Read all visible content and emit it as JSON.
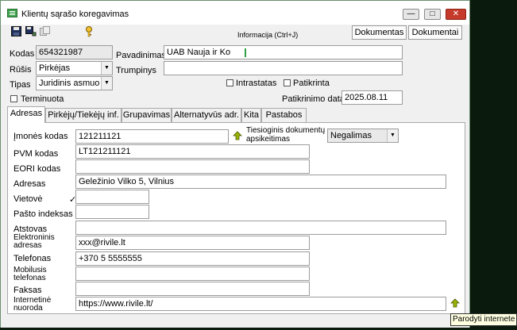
{
  "window": {
    "title": "Klientų sąrašo koregavimas",
    "controls": {
      "minimize": "—",
      "maximize": "□",
      "close": "✕"
    }
  },
  "toolbar": {
    "icons": [
      "save-icon",
      "save-copy-icon",
      "copy-icon",
      "key-icon"
    ],
    "info_text": "Informacija (Ctrl+J)",
    "buttons": [
      "Dokumentas",
      "Dokumentai"
    ]
  },
  "header": {
    "kodas_label": "Kodas",
    "kodas_value": "654321987",
    "rusis_label": "Rūšis",
    "rusis_value": "Pirkėjas",
    "tipas_label": "Tipas",
    "tipas_value": "Juridinis asmuo",
    "terminuota_label": "Terminuota",
    "pavadinimas_label": "Pavadinimas",
    "pavadinimas_value": "UAB Nauja ir Ko",
    "trumpinys_label": "Trumpinys",
    "trumpinys_value": "",
    "intrastatas_label": "Intrastatas",
    "patikrinta_label": "Patikrinta",
    "patikrinimo_data_label": "Patikrinimo data",
    "patikrinimo_data_value": "2025.08.11"
  },
  "tabs": [
    "Adresas",
    "Pirkėjų/Tiekėjų inf.",
    "Grupavimas",
    "Alternatyvūs adr.",
    "Kita",
    "Pastabos"
  ],
  "adresas": {
    "imones_kodas_label": "Įmonės kodas",
    "imones_kodas_value": "121211121",
    "tiesioginis_label_1": "Tiesioginis dokumentų",
    "tiesioginis_label_2": "apsikeitimas",
    "tiesioginis_value": "Negalimas",
    "pvm_label": "PVM kodas",
    "pvm_value": "LT121211121",
    "eori_label": "EORI kodas",
    "eori_value": "",
    "adresas_label": "Adresas",
    "adresas_value": "Geležinio Vilko 5, Vilnius",
    "vietove_label": "Vietovė",
    "vietove_value": "",
    "vietove_mark": "✓",
    "pasto_label": "Pašto indeksas",
    "pasto_value": "",
    "atstovas_label": "Atstovas",
    "atstovas_value": "",
    "el_label_1": "Elektroninis",
    "el_label_2": "adresas",
    "el_value": "xxx@rivile.lt",
    "telefonas_label": "Telefonas",
    "telefonas_value": "+370 5 5555555",
    "mob_label_1": "Mobilusis",
    "mob_label_2": "telefonas",
    "mob_value": "",
    "faksas_label": "Faksas",
    "faksas_value": "",
    "url_label_1": "Internetinė",
    "url_label_2": "nuoroda",
    "url_value": "https://www.rivile.lt/",
    "tooltip": "Parodyti internete"
  }
}
